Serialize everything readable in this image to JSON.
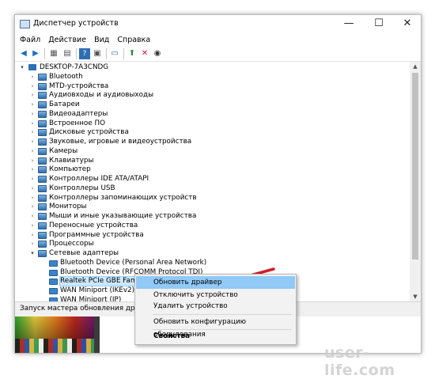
{
  "window": {
    "title": "Диспетчер устройств",
    "controls": {
      "minimize": "—",
      "maximize": "☐",
      "close": "✕"
    }
  },
  "menubar": [
    "Файл",
    "Действие",
    "Вид",
    "Справка"
  ],
  "toolbar": {
    "icons": [
      "back-icon",
      "forward-icon",
      "properties-icon",
      "hide-icon",
      "help-icon",
      "view-icon",
      "monitor-icon",
      "update-driver-icon",
      "uninstall-icon",
      "scan-icon"
    ]
  },
  "tree": {
    "root": "DESKTOP-7A3CNDG",
    "categories": [
      "Bluetooth",
      "MTD-устройства",
      "Аудиовходы и аудиовыходы",
      "Батареи",
      "Видеоадаптеры",
      "Встроенное ПО",
      "Дисковые устройства",
      "Звуковые, игровые и видеоустройства",
      "Камеры",
      "Клавиатуры",
      "Компьютер",
      "Контроллеры IDE ATA/ATAPI",
      "Контроллеры USB",
      "Контроллеры запоминающих устройств",
      "Мониторы",
      "Мыши и иные указывающие устройства",
      "Переносные устройства",
      "Программные устройства",
      "Процессоры",
      "Сетевые адаптеры"
    ],
    "network_children": [
      "Bluetooth Device (Personal Area Network)",
      "Bluetooth Device (RFCOMM Protocol TDI)",
      "Realtek PCIe GBE Family Co",
      "WAN Miniport (IKEv2)",
      "WAN Miniport (IP)"
    ]
  },
  "statusbar": {
    "text": "Запуск мастера обновления драйверов д"
  },
  "context_menu": {
    "items": [
      "Обновить драйвер",
      "Отключить устройство",
      "Удалить устройство",
      "Обновить конфигурацию оборудования",
      "Свойства"
    ],
    "highlighted": "Обновить драйвер"
  },
  "watermark": "user-life.com",
  "colors": {
    "highlight": "#91c9f7",
    "arrow": "#d11f2a",
    "selection": "#cce8ff"
  }
}
